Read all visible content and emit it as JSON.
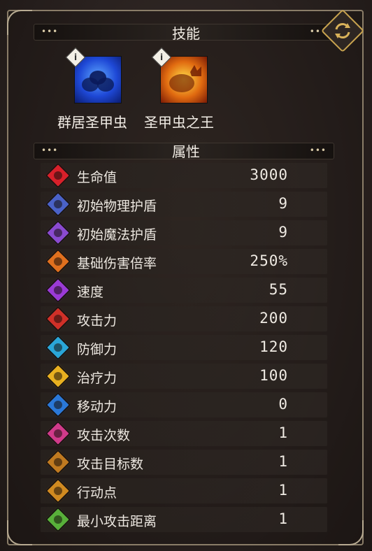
{
  "skills_section": {
    "title": "技能",
    "skills": [
      {
        "name": "群居圣甲虫",
        "icon": "scarab-swarm-icon",
        "badge": "i",
        "color": "#1e48d6"
      },
      {
        "name": "圣甲虫之王",
        "icon": "scarab-king-icon",
        "badge": "i",
        "color": "#e06a10"
      }
    ]
  },
  "attributes_section": {
    "title": "属性",
    "rows": [
      {
        "label": "生命值",
        "value": "3000",
        "icon": "heart-icon",
        "color": "#d8202a"
      },
      {
        "label": "初始物理护盾",
        "value": "9",
        "icon": "physical-shield-icon",
        "color": "#4a62c8"
      },
      {
        "label": "初始魔法护盾",
        "value": "9",
        "icon": "magic-shield-icon",
        "color": "#8a4ad0"
      },
      {
        "label": "基础伤害倍率",
        "value": "250%",
        "icon": "hammer-icon",
        "color": "#e0701e"
      },
      {
        "label": "速度",
        "value": "55",
        "icon": "speed-icon",
        "color": "#9a3ad6"
      },
      {
        "label": "攻击力",
        "value": "200",
        "icon": "sword-icon",
        "color": "#d03028"
      },
      {
        "label": "防御力",
        "value": "120",
        "icon": "armor-icon",
        "color": "#2aa6d8"
      },
      {
        "label": "治疗力",
        "value": "100",
        "icon": "heal-cross-icon",
        "color": "#e8b020"
      },
      {
        "label": "移动力",
        "value": "0",
        "icon": "boot-icon",
        "color": "#2a78d8"
      },
      {
        "label": "攻击次数",
        "value": "1",
        "icon": "attack-count-icon",
        "color": "#d03a8a"
      },
      {
        "label": "攻击目标数",
        "value": "1",
        "icon": "targets-icon",
        "color": "#c07a20"
      },
      {
        "label": "行动点",
        "value": "1",
        "icon": "action-point-icon",
        "color": "#d08a20"
      },
      {
        "label": "最小攻击距离",
        "value": "1",
        "icon": "range-icon",
        "color": "#58b03a"
      }
    ]
  },
  "colors": {
    "border": "#8a7d68",
    "accent": "#c8a34f"
  },
  "header_decor": "•••"
}
